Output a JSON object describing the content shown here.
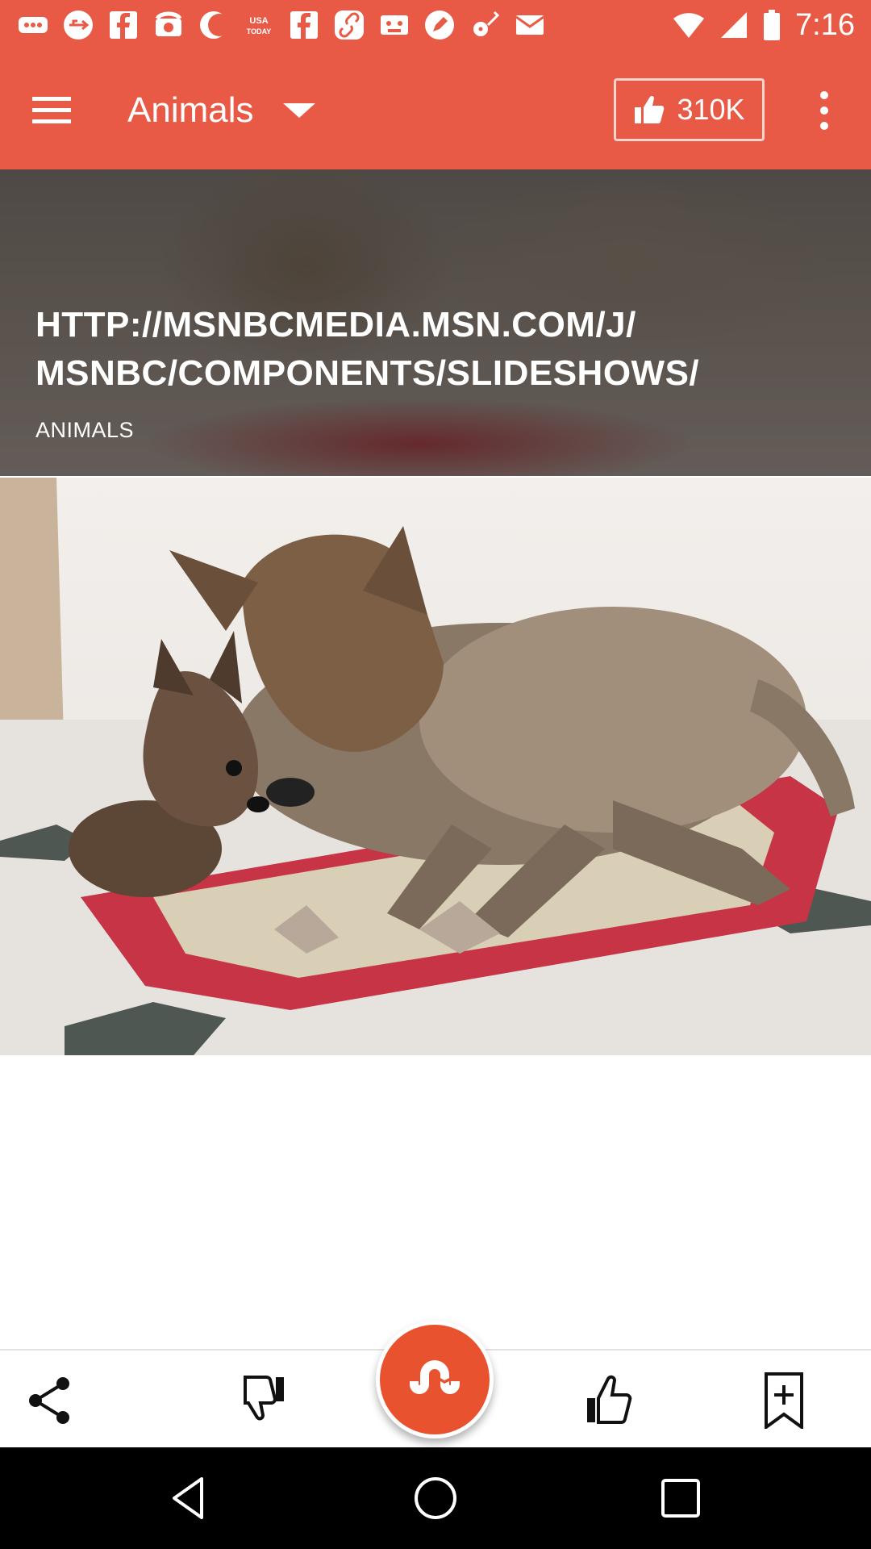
{
  "status_bar": {
    "time": "7:16",
    "notification_icons": [
      "more-horiz-icon",
      "usb-icon",
      "facebook-icon",
      "phone-icon",
      "moon-icon",
      "usa-today-icon",
      "facebook-icon",
      "link-icon",
      "cassette-icon",
      "pencil-icon",
      "guitar-icon",
      "mail-icon"
    ],
    "usa_today_text": "USA TODAY"
  },
  "app_bar": {
    "category_label": "Animals",
    "likes_count": "310K",
    "accent_color": "#e85a45"
  },
  "header": {
    "url_line1": "HTTP://MSNBCMEDIA.MSN.COM/J/",
    "url_line2": "MSNBC/COMPONENTS/SLIDESHOWS/",
    "tag": "ANIMALS"
  },
  "main_image": {
    "subject": "dog-and-fawn-photo"
  },
  "bottom_bar": {
    "actions": [
      "share-icon",
      "thumbs-down-icon",
      "stumble-icon",
      "thumbs-up-icon",
      "bookmark-add-icon"
    ],
    "fab_color": "#e8522f"
  },
  "nav_bar": {
    "buttons": [
      "back-icon",
      "home-icon",
      "recents-icon"
    ]
  }
}
